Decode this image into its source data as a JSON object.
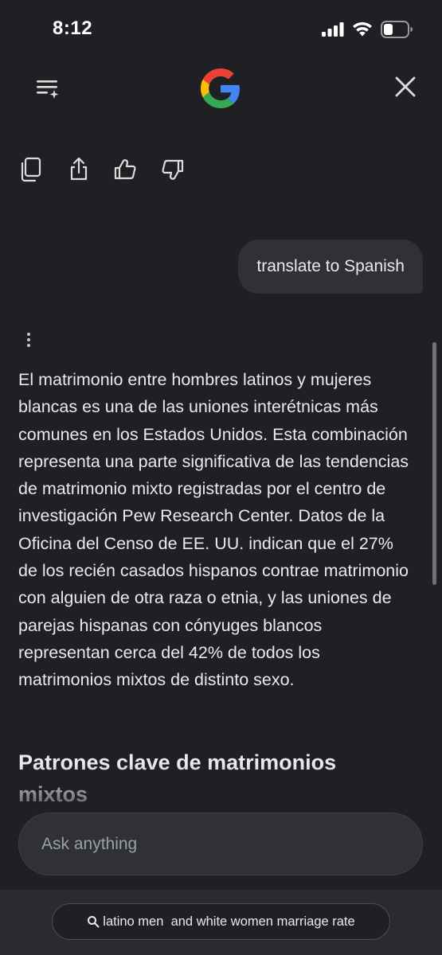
{
  "status_bar": {
    "time": "8:12"
  },
  "header": {
    "logo_icon": "google-g-logo",
    "left_icon": "history-sparkle-icon",
    "right_icon": "close-icon"
  },
  "actions": {
    "icons": [
      "copy-icon",
      "share-icon",
      "thumbs-up-icon",
      "thumbs-down-icon"
    ]
  },
  "conversation": {
    "user_message": "translate to Spanish",
    "response_text": "El matrimonio entre hombres latinos y mujeres blancas es una de las uniones interétnicas más comunes en los Estados Unidos. Esta combinación representa una parte significativa de las tendencias de matrimonio mixto registradas por el centro de investigación Pew Research Center. Datos de la Oficina del Censo de EE. UU. indican que el 27% de los recién casados hispanos contrae matrimonio con alguien de otra raza o etnia, y las uniones de parejas hispanas con cónyuges blancos representan cerca del 42% de todos los matrimonios mixtos de distinto sexo.",
    "section_heading": "Patrones clave de matrimonios mixtos"
  },
  "input": {
    "placeholder": "Ask anything"
  },
  "suggestion": {
    "text": "latino men  and white women marriage rate"
  },
  "colors": {
    "background": "#1f2023",
    "bubble": "#303134",
    "text": "#e8eaed",
    "placeholder": "#9aa0a6"
  }
}
